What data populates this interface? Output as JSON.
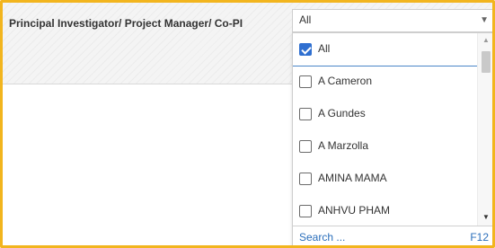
{
  "filter": {
    "label": "Principal Investigator/ Project Manager/ Co-PI",
    "selected_value": "All"
  },
  "dropdown": {
    "options": [
      {
        "label": "All",
        "checked": true
      },
      {
        "label": "A Cameron",
        "checked": false
      },
      {
        "label": "A Gundes",
        "checked": false
      },
      {
        "label": "A Marzolla",
        "checked": false
      },
      {
        "label": "AMINA MAMA",
        "checked": false
      },
      {
        "label": "ANHVU PHAM",
        "checked": false
      }
    ],
    "search_label": "Search ...",
    "search_shortcut": "F12"
  },
  "colors": {
    "frame_border": "#f2b51e",
    "checkbox_checked": "#2f6fd0",
    "link": "#2a6ebb"
  },
  "icons": {
    "select_arrow": "chevron-down-icon",
    "scroll_up": "arrow-up-icon",
    "scroll_down": "arrow-down-icon"
  }
}
